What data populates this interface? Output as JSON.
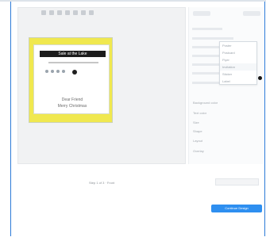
{
  "canvas": {
    "caption": "Step 1 of 3 · Front"
  },
  "card": {
    "title": "Sale at the Lake",
    "name_line_1": "Dear Friend",
    "name_line_2": "Merry Christmas"
  },
  "panel": {
    "header_left": "",
    "header_right": "",
    "sections": [
      "Background color",
      "Text color",
      "Size",
      "Shape",
      "Layout",
      "Overlay"
    ]
  },
  "dropdown": {
    "items": [
      "Poster",
      "Postcard",
      "Flyer",
      "Invitation",
      "Sticker",
      "Label"
    ],
    "selected_index": 3
  },
  "primary_action": {
    "label": "Continue Design"
  }
}
